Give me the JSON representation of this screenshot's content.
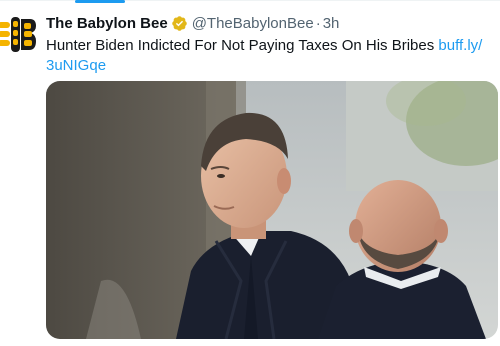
{
  "tweet": {
    "author_name": "The Babylon Bee",
    "handle": "@TheBabylonBee",
    "separator": "·",
    "time": "3h",
    "text": "Hunter Biden Indicted For Not Paying Taxes On His Bribes",
    "link_line1": "buff.ly/",
    "link_line2": "3uNIGqe"
  },
  "icons": {
    "avatar": "babylon-bee-logo",
    "verified": "gold-verified-badge"
  },
  "colors": {
    "text": "#0f1419",
    "secondary": "#536471",
    "link": "#1d9bf0",
    "verified": "#e2b719",
    "avatar": "#f5b400"
  }
}
